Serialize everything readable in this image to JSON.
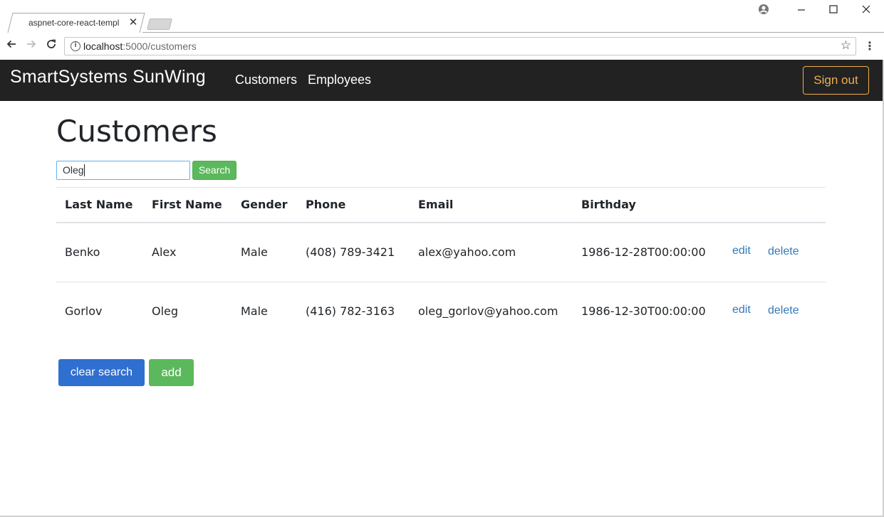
{
  "browser": {
    "tab_title": "aspnet-core-react-templ",
    "tab_close": "✕",
    "url_host": "localhost",
    "url_path": ":5000/customers",
    "icons": {
      "back": "back-arrow-icon",
      "forward": "forward-arrow-icon",
      "reload": "reload-icon",
      "info": "info-icon",
      "bookmark": "star-icon",
      "menu": "kebab-menu-icon",
      "profile": "profile-icon",
      "minimize": "minimize-icon",
      "maximize": "maximize-icon",
      "close": "close-icon"
    }
  },
  "navbar": {
    "brand": "SmartSystems SunWing",
    "links": [
      "Customers",
      "Employees"
    ],
    "signout_label": "Sign out",
    "accent_color": "#f0ad4e",
    "background": "#222222"
  },
  "main": {
    "title": "Customers",
    "search": {
      "value": "Oleg",
      "button_label": "Search"
    },
    "table": {
      "headers": [
        "Last Name",
        "First Name",
        "Gender",
        "Phone",
        "Email",
        "Birthday"
      ],
      "rows": [
        {
          "last_name": "Benko",
          "first_name": "Alex",
          "gender": "Male",
          "phone": "(408) 789-3421",
          "email": "alex@yahoo.com",
          "birthday": "1986-12-28T00:00:00",
          "edit": "edit",
          "delete": "delete"
        },
        {
          "last_name": "Gorlov",
          "first_name": "Oleg",
          "gender": "Male",
          "phone": "(416) 782-3163",
          "email": "oleg_gorlov@yahoo.com",
          "birthday": "1986-12-30T00:00:00",
          "edit": "edit",
          "delete": "delete"
        }
      ]
    },
    "clear_label": "clear search",
    "add_label": "add"
  }
}
